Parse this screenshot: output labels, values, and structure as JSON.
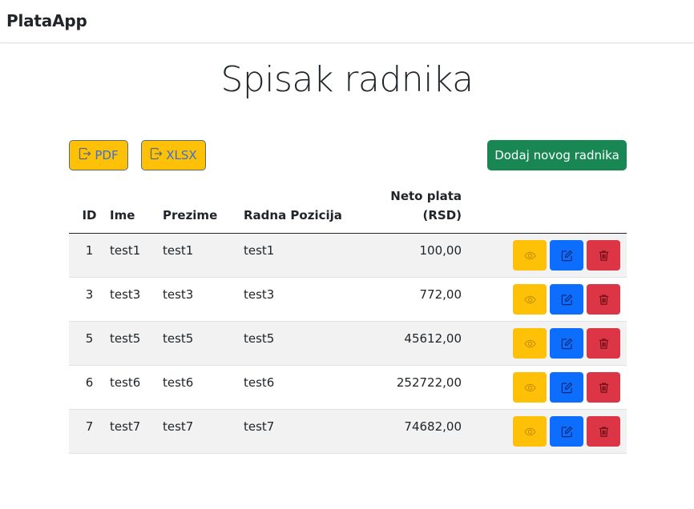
{
  "app": {
    "brand": "PlataApp"
  },
  "page": {
    "title": "Spisak radnika"
  },
  "toolbar": {
    "pdf_label": "PDF",
    "xlsx_label": "XLSX",
    "add_label": "Dodaj novog radnika"
  },
  "table": {
    "headers": {
      "id": "ID",
      "ime": "Ime",
      "prezime": "Prezime",
      "pozicija": "Radna Pozicija",
      "neto_line1": "Neto plata",
      "neto_line2": "(RSD)"
    },
    "rows": [
      {
        "id": "1",
        "ime": "test1",
        "prezime": "test1",
        "pozicija": "test1",
        "neto": "100,00"
      },
      {
        "id": "3",
        "ime": "test3",
        "prezime": "test3",
        "pozicija": "test3",
        "neto": "772,00"
      },
      {
        "id": "5",
        "ime": "test5",
        "prezime": "test5",
        "pozicija": "test5",
        "neto": "45612,00"
      },
      {
        "id": "6",
        "ime": "test6",
        "prezime": "test6",
        "pozicija": "test6",
        "neto": "252722,00"
      },
      {
        "id": "7",
        "ime": "test7",
        "prezime": "test7",
        "pozicija": "test7",
        "neto": "74682,00"
      }
    ]
  },
  "icons": {
    "export": "box-arrow-right-icon",
    "view": "eye-icon",
    "edit": "pencil-square-icon",
    "delete": "trash-icon"
  },
  "colors": {
    "warning": "#ffc107",
    "primary": "#0d6efd",
    "danger": "#dc3545",
    "success": "#198754",
    "stripe": "#f2f2f2"
  }
}
